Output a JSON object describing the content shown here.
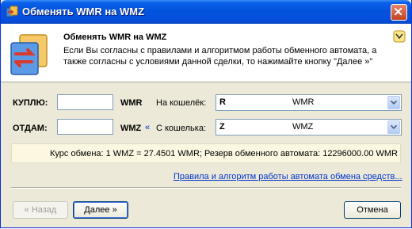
{
  "window": {
    "title": "Обменять WMR на  WMZ"
  },
  "header": {
    "title": "Обменять WMR на  WMZ",
    "description": "Если Вы согласны с правилами и алгоритмом работы обменного автомата, а также согласны с условиями данной сделки, то нажимайте кнопку \"Далее »\""
  },
  "buy": {
    "label": "КУПЛЮ:",
    "amount": "",
    "currency": "WMR",
    "purse_label": "На кошелёк:",
    "purse_code": "R",
    "purse_name": "WMR"
  },
  "give": {
    "label": "ОТДАМ:",
    "amount": "",
    "currency": "WMZ",
    "arrow": "«",
    "purse_label": "С кошелька:",
    "purse_code": "Z",
    "purse_name": "WMZ"
  },
  "rate": {
    "text": "Курс обмена: 1 WMZ = 27.4501 WMR; Резерв обменного автомата: 12296000.00 WMR"
  },
  "rules_link": "Правила и алгоритм работы автомата обмена средств...",
  "buttons": {
    "back": "« Назад",
    "next": "Далее »",
    "cancel": "Отмена"
  },
  "icons": {
    "title": "exchange-icon",
    "header": "exchange-icon",
    "help": "help-icon",
    "close": "close-icon",
    "dropdown": "chevron-down-icon"
  }
}
